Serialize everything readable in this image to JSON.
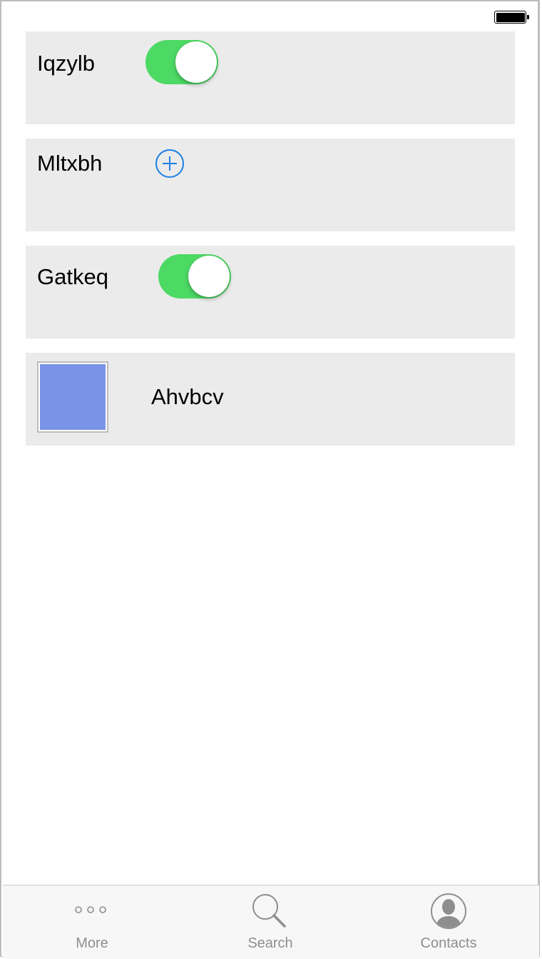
{
  "status_bar": {
    "battery_icon": "battery-full-icon",
    "battery_level": 1.0
  },
  "rows": [
    {
      "label": "Iqzylb",
      "control": "toggle",
      "on": true
    },
    {
      "label": "Mltxbh",
      "control": "add-button",
      "icon": "plus-circle-icon"
    },
    {
      "label": "Gatkeq",
      "control": "toggle",
      "on": true
    },
    {
      "label": "Ahvbcv",
      "control": "image",
      "image_color": "#7b93e6"
    }
  ],
  "tabbar": {
    "tabs": [
      {
        "label": "More",
        "icon": "more-dots-icon"
      },
      {
        "label": "Search",
        "icon": "magnifier-icon"
      },
      {
        "label": "Contacts",
        "icon": "contact-silhouette-icon"
      }
    ]
  },
  "colors": {
    "toggle_on": "#4cd964",
    "accent_blue": "#1a7fe6",
    "card_bg": "#ebebeb",
    "tab_inactive": "#8e8e8e"
  }
}
